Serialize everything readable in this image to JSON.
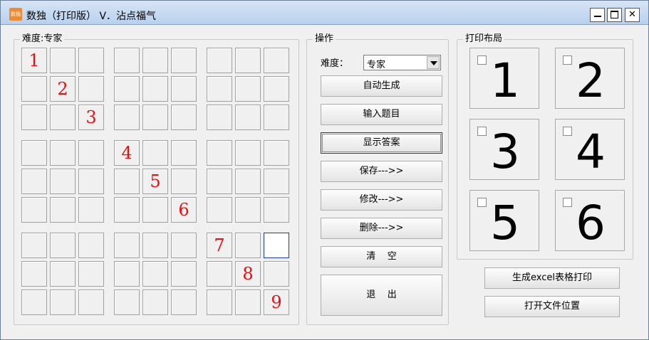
{
  "window": {
    "icon_text": "数独",
    "title": "数独（打印版） V．沾点福气"
  },
  "grid_group": {
    "title": "难度:专家",
    "cells": [
      [
        "1",
        "",
        "",
        "",
        "",
        "",
        "",
        "",
        ""
      ],
      [
        "",
        "2",
        "",
        "",
        "",
        "",
        "",
        "",
        ""
      ],
      [
        "",
        "",
        "3",
        "",
        "",
        "",
        "",
        "",
        ""
      ],
      [
        "",
        "",
        "",
        "4",
        "",
        "",
        "",
        "",
        ""
      ],
      [
        "",
        "",
        "",
        "",
        "5",
        "",
        "",
        "",
        ""
      ],
      [
        "",
        "",
        "",
        "",
        "",
        "6",
        "",
        "",
        ""
      ],
      [
        "",
        "",
        "",
        "",
        "",
        "",
        "7",
        "",
        ""
      ],
      [
        "",
        "",
        "",
        "",
        "",
        "",
        "",
        "8",
        ""
      ],
      [
        "",
        "",
        "",
        "",
        "",
        "",
        "",
        "",
        "9"
      ]
    ],
    "selected_cell": [
      6,
      8
    ]
  },
  "ops": {
    "title": "操作",
    "difficulty_label": "难度：",
    "difficulty_value": "专家",
    "buttons": {
      "auto_generate": "自动生成",
      "input_puzzle": "输入题目",
      "show_answer": "显示答案",
      "save": "保存--->>",
      "modify": "修改--->>",
      "delete": "删除--->>",
      "clear": "清    空",
      "exit": "退    出"
    }
  },
  "print_layout": {
    "title": "打印布局",
    "layouts": [
      "1",
      "2",
      "3",
      "4",
      "5",
      "6"
    ]
  },
  "footer_buttons": {
    "generate_excel": "生成excel表格打印",
    "open_location": "打开文件位置"
  },
  "colors": {
    "given_digit": "#e81010",
    "selected_border": "#1a3fa8"
  }
}
